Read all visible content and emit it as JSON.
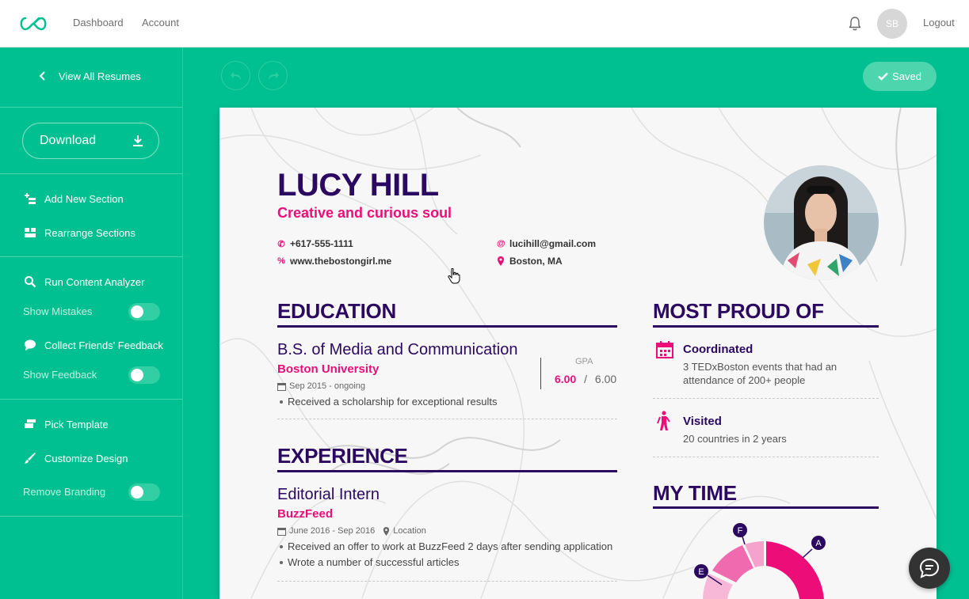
{
  "nav": {
    "dashboard": "Dashboard",
    "account": "Account",
    "avatar_initials": "SB",
    "logout": "Logout"
  },
  "sidebar": {
    "view_all": "View All Resumes",
    "download": "Download",
    "add_section": "Add New Section",
    "rearrange": "Rearrange Sections",
    "analyzer": "Run Content Analyzer",
    "show_mistakes": "Show Mistakes",
    "feedback": "Collect Friends' Feedback",
    "show_feedback": "Show Feedback",
    "pick_template": "Pick Template",
    "customize": "Customize Design",
    "remove_branding": "Remove Branding"
  },
  "toolbar": {
    "saved": "Saved"
  },
  "resume": {
    "name": "LUCY HILL",
    "tagline": "Creative and curious soul",
    "phone": "+617-555-1111",
    "website": "www.thebostongirl.me",
    "email": "lucihill@gmail.com",
    "location": "Boston, MA",
    "education": {
      "title": "EDUCATION",
      "degree": "B.S. of Media and Communication",
      "school": "Boston University",
      "dates": "Sep 2015 - ongoing",
      "bullet": "Received a scholarship for exceptional results",
      "gpa_label": "GPA",
      "gpa_value": "6.00",
      "gpa_sep": "/",
      "gpa_max": "6.00"
    },
    "experience": {
      "title": "EXPERIENCE",
      "role": "Editorial Intern",
      "company": "BuzzFeed",
      "dates": "June 2016 - Sep 2016",
      "location": "Location",
      "bullets": [
        "Received an offer to work at BuzzFeed 2 days after sending application",
        "Wrote a number of successful articles"
      ]
    },
    "proud": {
      "title": "MOST PROUD OF",
      "items": [
        {
          "title": "Coordinated",
          "desc1": "3 TEDxBoston events that had an",
          "desc2": "attendance of 200+ people"
        },
        {
          "title": "Visited",
          "desc1": "20 countries in 2 years"
        }
      ]
    },
    "time": {
      "title": "MY TIME",
      "labels": [
        "A",
        "E",
        "F"
      ]
    }
  },
  "colors": {
    "brand": "#00c091",
    "navy": "#2c0960",
    "pink": "#ec0d79"
  }
}
